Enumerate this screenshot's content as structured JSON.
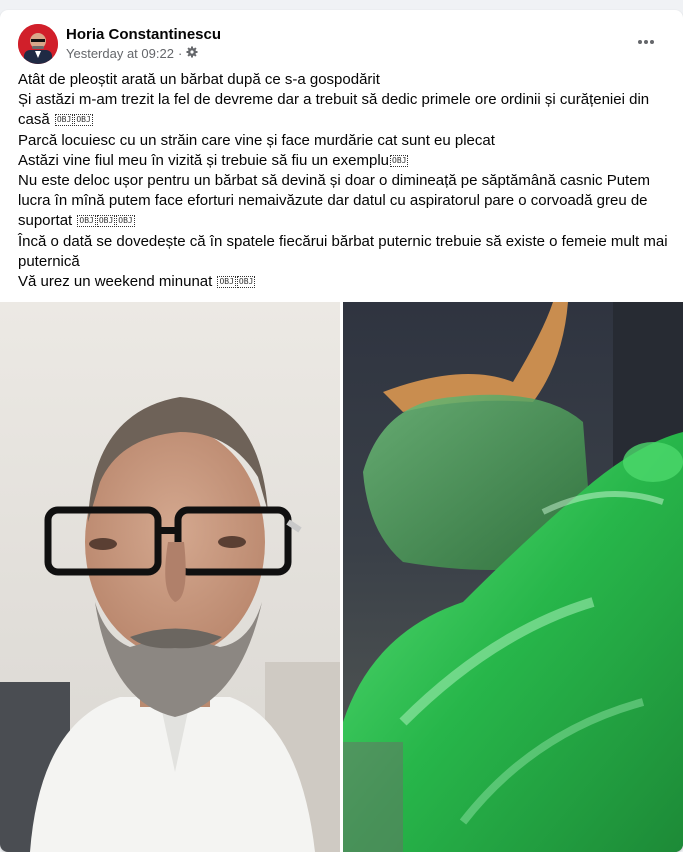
{
  "post": {
    "author": "Horia Constantinescu",
    "timestamp": "Yesterday at 09:22",
    "separator": "·",
    "icons": {
      "privacy": "gear-icon",
      "menu": "more-options-icon"
    },
    "lines": [
      {
        "text": "Atât de pleoștit arată un bărbat după ce s-a gospodărit",
        "emoji": []
      },
      {
        "text": "Și astăzi m-am trezit la fel de devreme dar a trebuit să dedic primele ore ordinii și curățeniei din casă ",
        "emoji": [
          "OBJ",
          "OBJ"
        ]
      },
      {
        "text": "Parcă locuiesc cu un străin care vine și face murdărie cat sunt eu plecat",
        "emoji": []
      },
      {
        "text": "Astăzi vine fiul meu în vizită și trebuie să fiu un exemplu",
        "emoji": [
          "OBJ"
        ]
      },
      {
        "text": "Nu este deloc ușor pentru un bărbat să devină și doar o dimineață pe săptămână casnic Putem lucra în mînă putem face eforturi nemaivăzute dar datul cu aspiratorul pare o corvoadă greu de suportat ",
        "emoji": [
          "OBJ",
          "OBJ",
          "OBJ"
        ]
      },
      {
        "text": "Încă o dată se dovedește că în spatele fiecărui bărbat puternic trebuie să existe o femeie mult mai puternică",
        "emoji": []
      },
      {
        "text": "Vă urez un weekend minunat ",
        "emoji": [
          "OBJ",
          "OBJ"
        ]
      }
    ]
  },
  "photos": [
    {
      "subject": "man-with-glasses-selfie"
    },
    {
      "subject": "green-trash-bags"
    }
  ],
  "colors": {
    "card": "#ffffff",
    "background": "#f0f2f5",
    "text": "#050505",
    "meta": "#65676b",
    "avatar": "#d11f2a"
  }
}
